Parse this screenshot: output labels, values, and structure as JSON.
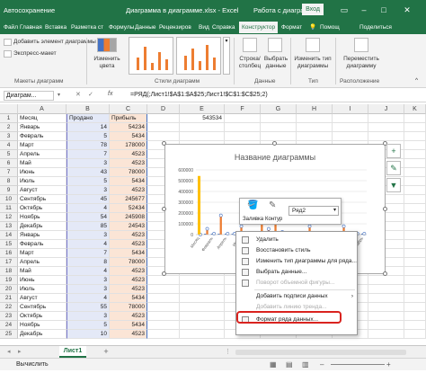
{
  "titlebar": {
    "autosave": "Автосохранение",
    "document_title": "Диаграмма в диаграмме.xlsx - Excel",
    "context_title": "Работа с диаграм...",
    "login_label": "Вход"
  },
  "tabs": [
    "Файл",
    "Главная",
    "Вставка",
    "Разметка ст",
    "Формулы",
    "Данные",
    "Рецензиров",
    "Вид",
    "Справка",
    "Конструктор",
    "Формат",
    "Помощ",
    "Поделиться"
  ],
  "ribbon": {
    "add_element": "Добавить элемент диаграммы",
    "express_layout": "Экспресс-макет",
    "layouts_label": "Макеты диаграмм",
    "change_colors": "Изменить цвета",
    "styles_label": "Стили диаграмм",
    "row_col": "Строка/ столбец",
    "select_data": "Выбрать данные",
    "data_label": "Данные",
    "change_type": "Изменить тип диаграммы",
    "type_label": "Тип",
    "move_chart": "Переместить диаграмму",
    "location_label": "Расположение"
  },
  "formula_bar": {
    "name_box": "Диаграм...",
    "fx": "fx",
    "formula": "=РЯД(;Лист1!$A$1:$A$25;Лист1!$C$1:$C$25;2)"
  },
  "columns": [
    "A",
    "B",
    "C",
    "D",
    "E",
    "F",
    "G",
    "H",
    "I",
    "J",
    "K"
  ],
  "extra_value": "543534",
  "rows": [
    [
      "Месяц",
      "Продано",
      "Прибыль"
    ],
    [
      "Январь",
      "14",
      "54234"
    ],
    [
      "Февраль",
      "5",
      "5434"
    ],
    [
      "Март",
      "78",
      "178000"
    ],
    [
      "Апрель",
      "7",
      "4523"
    ],
    [
      "Май",
      "3",
      "4523"
    ],
    [
      "Июнь",
      "43",
      "78000"
    ],
    [
      "Июль",
      "5",
      "5434"
    ],
    [
      "Август",
      "3",
      "4523"
    ],
    [
      "Сентябрь",
      "45",
      "245677"
    ],
    [
      "Октябрь",
      "4",
      "52434"
    ],
    [
      "Ноябрь",
      "54",
      "245908"
    ],
    [
      "Декабрь",
      "85",
      "24543"
    ],
    [
      "Январь",
      "3",
      "4523"
    ],
    [
      "Февраль",
      "4",
      "4523"
    ],
    [
      "Март",
      "7",
      "5434"
    ],
    [
      "Апрель",
      "8",
      "78000"
    ],
    [
      "Май",
      "4",
      "4523"
    ],
    [
      "Июнь",
      "3",
      "4523"
    ],
    [
      "Июль",
      "3",
      "4523"
    ],
    [
      "Август",
      "4",
      "5434"
    ],
    [
      "Сентябрь",
      "55",
      "78000"
    ],
    [
      "Октябрь",
      "3",
      "4523"
    ],
    [
      "Ноябрь",
      "5",
      "5434"
    ],
    [
      "Декабрь",
      "10",
      "4523"
    ]
  ],
  "chart_data": {
    "type": "bar",
    "title": "Название диаграммы",
    "ylim": [
      0,
      600000
    ],
    "yticks": [
      "600000",
      "500000",
      "400000",
      "300000",
      "200000",
      "100000",
      "0"
    ],
    "categories": [
      "Месяц",
      "Февраль",
      "Апрель",
      "Июнь",
      "Август",
      "Октябрь",
      "Декабрь",
      "Февраль",
      "Апрель",
      "Июнь",
      "Август",
      "Октябрь",
      "Декабрь"
    ],
    "series": [
      {
        "values": [
          0,
          14,
          5,
          78,
          7,
          3,
          43,
          5,
          3,
          45,
          4,
          54,
          85,
          3,
          4,
          7,
          8,
          4,
          3,
          3,
          4,
          55,
          3,
          5,
          10
        ],
        "color": "#4472c4"
      },
      {
        "values": [
          0,
          54234,
          5434,
          178000,
          4523,
          4523,
          78000,
          5434,
          4523,
          245677,
          52434,
          245908,
          24543,
          4523,
          4523,
          5434,
          78000,
          4523,
          4523,
          4523,
          5434,
          78000,
          4523,
          5434,
          4523
        ],
        "color": "#ed7d31"
      }
    ],
    "extra_bar": {
      "value": 543534,
      "color": "#ffc000"
    }
  },
  "mini_toolbar": {
    "fill_label": "Заливка",
    "outline_label": "Контур",
    "series_select": "Ряд2"
  },
  "context_menu": [
    {
      "label": "Удалить",
      "disabled": false
    },
    {
      "label": "Восстановить стиль",
      "disabled": false
    },
    {
      "label": "Изменить тип диаграммы для ряда...",
      "disabled": false
    },
    {
      "label": "Выбрать данные...",
      "disabled": false
    },
    {
      "label": "Поворот объемной фигуры...",
      "disabled": true
    },
    {
      "label": "Добавить подписи данных",
      "disabled": false
    },
    {
      "label": "Добавить линию тренда...",
      "disabled": true
    },
    {
      "label": "Формат ряда данных...",
      "disabled": false
    }
  ],
  "sheet_tabs": {
    "active": "Лист1",
    "add": "+"
  },
  "status": {
    "text": "Вычислить"
  }
}
